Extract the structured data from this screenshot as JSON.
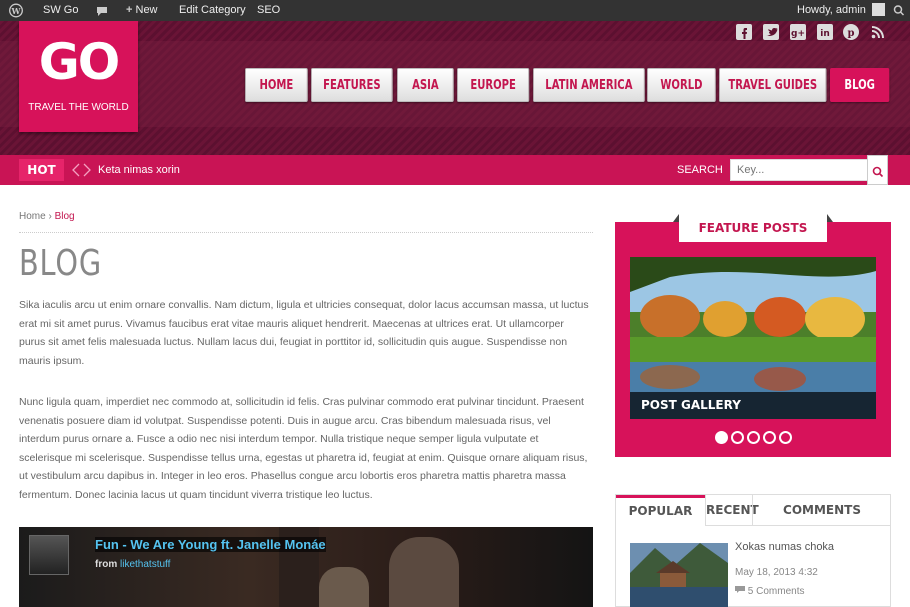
{
  "admin_bar": {
    "site_name": "SW Go",
    "new_label": "New",
    "edit_label": "Edit Category",
    "seo_label": "SEO",
    "howdy": "Howdy, admin"
  },
  "header": {
    "logo_text": "GO",
    "tagline": "TRAVEL THE WORLD",
    "social_icons": [
      "facebook-icon",
      "twitter-icon",
      "google-plus-icon",
      "linkedin-icon",
      "pinterest-icon",
      "rss-icon"
    ]
  },
  "nav": {
    "items": [
      "HOME",
      "FEATURES",
      "ASIA",
      "EUROPE",
      "LATIN AMERICA",
      "WORLD",
      "TRAVEL GUIDES",
      "BLOG"
    ],
    "active": "BLOG"
  },
  "hotbar": {
    "hot_label": "HOT",
    "ticker": "Keta nimas xorin",
    "search_label": "SEARCH",
    "search_placeholder": "Key..."
  },
  "breadcrumb": {
    "home": "Home",
    "current": "Blog"
  },
  "page": {
    "title": "BLOG",
    "para1": "Sika iaculis arcu ut enim ornare convallis. Nam dictum, ligula et ultricies consequat, dolor lacus accumsan massa, ut luctus erat mi sit amet purus. Vivamus faucibus erat vitae mauris aliquet hendrerit. Maecenas at ultrices erat. Ut ullamcorper purus sit amet felis malesuada luctus. Nullam lacus dui, feugiat in porttitor id, sollicitudin quis augue. Suspendisse non mauris ipsum.",
    "para2": "Nunc ligula quam, imperdiet nec commodo at, sollicitudin id felis. Cras pulvinar commodo erat pulvinar tincidunt. Praesent venenatis posuere diam id volutpat. Suspendisse potenti. Duis in augue arcu. Cras bibendum malesuada risus, vel interdum purus ornare a. Fusce a odio nec nisi interdum tempor. Nulla tristique neque semper ligula vulputate et scelerisque mi scelerisque. Suspendisse tellus urna, egestas ut pharetra id, feugiat at enim. Quisque ornare aliquam risus, ut vestibulum arcu dapibus in. Integer in leo eros. Phasellus congue arcu lobortis eros pharetra mattis pharetra massa fermentum. Donec lacinia lacus ut quam tincidunt viverra tristique leo luctus."
  },
  "video": {
    "title": "Fun - We Are Young ft. Janelle Monáe",
    "from_label": "from",
    "channel": "likethatstuff"
  },
  "feature": {
    "heading": "FEATURE POSTS",
    "caption": "POST GALLERY",
    "slide_count": 5,
    "active_slide": 1
  },
  "tabs": {
    "items": [
      "POPULAR",
      "RECENT",
      "COMMENTS"
    ],
    "active": "POPULAR",
    "post": {
      "title": "Xokas numas choka",
      "date": "May 18, 2013 4:32",
      "comments": "5 Comments"
    }
  },
  "colors": {
    "accent": "#d7125a",
    "header": "#5e1130",
    "admin": "#333333"
  }
}
